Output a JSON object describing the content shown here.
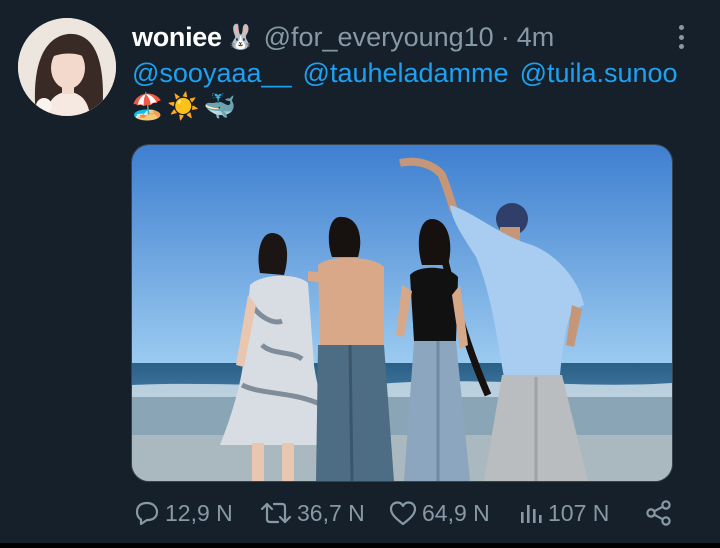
{
  "tweet": {
    "author": {
      "display_name": "woniee",
      "name_emoji": "🐰",
      "handle": "@for_everyoung10",
      "separator": "·",
      "time": "4m"
    },
    "mentions": [
      "@sooyaaa__",
      "@tauheladamme",
      "@tuila.sunoo"
    ],
    "emojis": [
      "🏖️",
      "☀️",
      "🐳"
    ],
    "actions": {
      "reply": {
        "icon": "reply-icon",
        "count": "12,9 N"
      },
      "retweet": {
        "icon": "retweet-icon",
        "count": "36,7 N"
      },
      "like": {
        "icon": "heart-icon",
        "count": "64,9 N"
      },
      "views": {
        "icon": "views-icon",
        "count": "107 N"
      },
      "share": {
        "icon": "share-icon"
      }
    }
  },
  "colors": {
    "background": "#15202b",
    "link": "#1da1f2",
    "muted": "#8899a6",
    "text": "#ffffff"
  }
}
